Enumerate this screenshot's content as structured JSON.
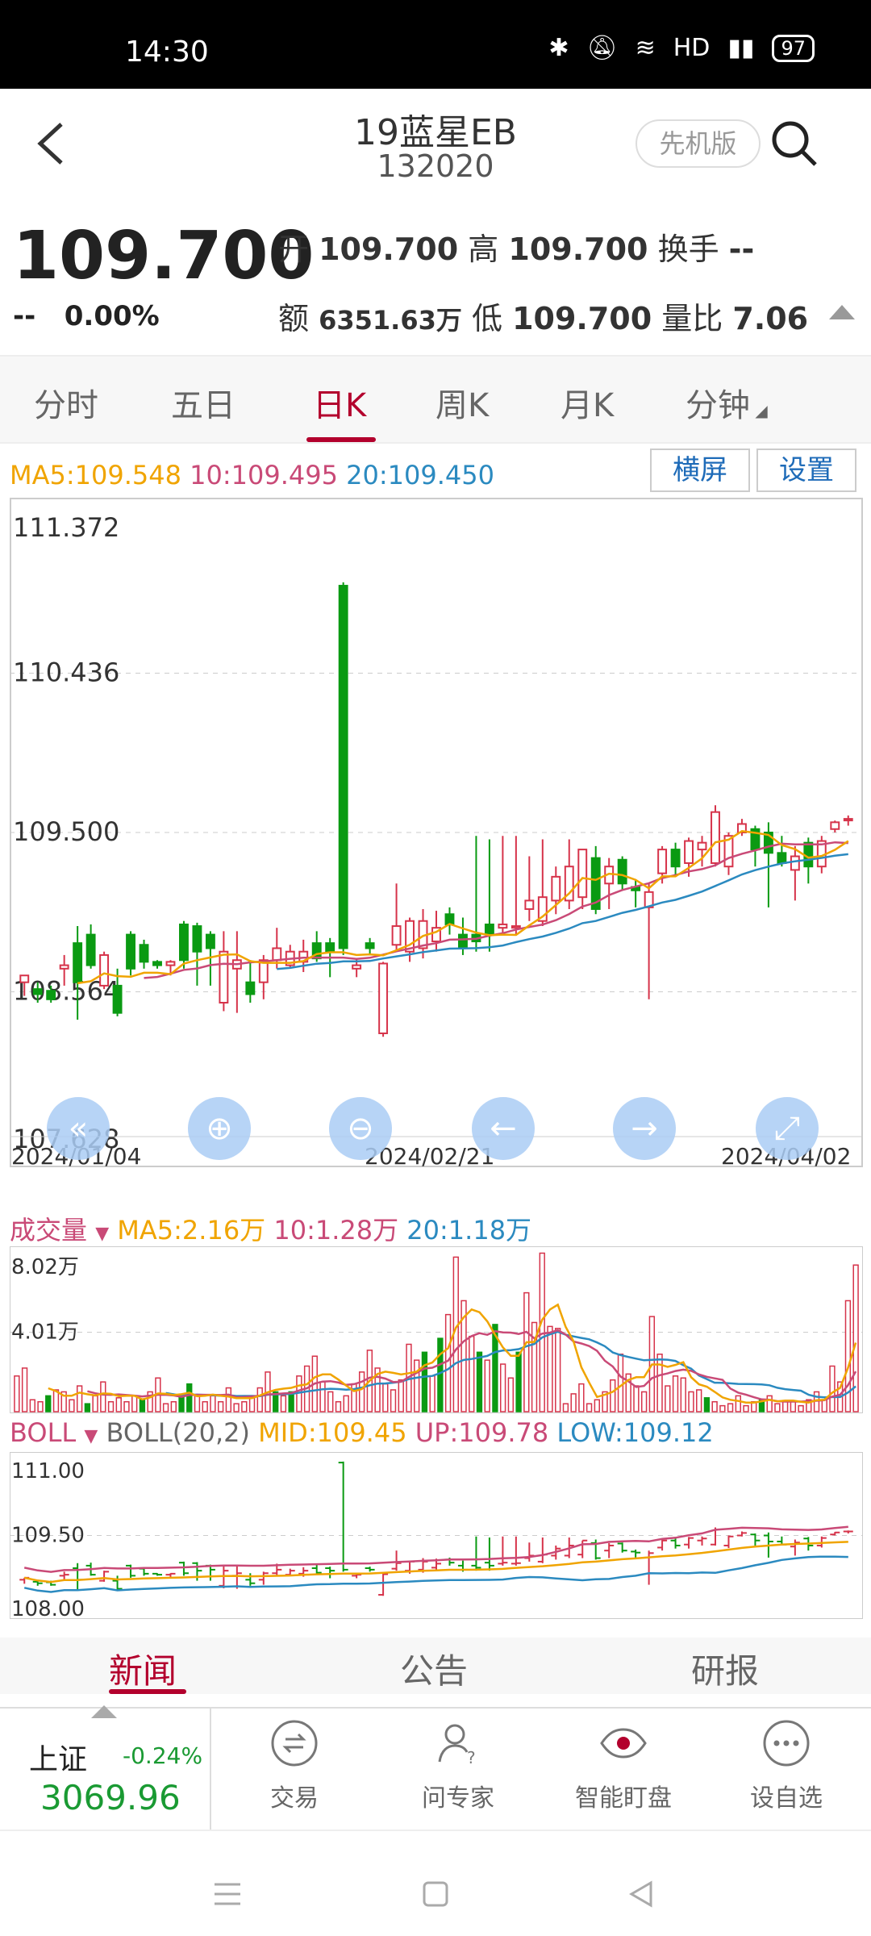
{
  "status": {
    "time": "14:30",
    "network": "HD",
    "battery": "97"
  },
  "header": {
    "title": "19蓝星EB",
    "code": "132020",
    "edition_label": "先机版"
  },
  "quote": {
    "price": "109.700",
    "change": "--",
    "change_pct": "0.00%",
    "open_label": "开",
    "open": "109.700",
    "high_label": "高",
    "high": "109.700",
    "turnover_label": "换手",
    "turnover": "--",
    "amount_label": "额",
    "amount": "6351.63万",
    "low_label": "低",
    "low": "109.700",
    "volratio_label": "量比",
    "volratio": "7.06"
  },
  "tabs": [
    "分时",
    "五日",
    "日K",
    "周K",
    "月K",
    "分钟"
  ],
  "active_tab": "日K",
  "ma": {
    "ma5": "MA5:109.548",
    "ma10": "10:109.495",
    "ma20": "20:109.450"
  },
  "chart_buttons": {
    "landscape": "横屏",
    "settings": "设置"
  },
  "chart_data": [
    {
      "type": "candlestick",
      "y_ticks": [
        "111.372",
        "110.436",
        "109.500",
        "108.564",
        "107.628"
      ],
      "ylim": [
        107.628,
        111.372
      ],
      "x_tick_labels": [
        "2024/01/04",
        "2024/02/21",
        "2024/04/02"
      ],
      "series_colors": {
        "up": "#d6334a",
        "down": "#0a9a12",
        "ma5": "#f0a400",
        "ma10": "#c94a77",
        "ma20": "#2b8ac0"
      },
      "candles": [
        [
          108.62,
          108.66,
          108.54,
          108.66
        ],
        [
          108.58,
          108.62,
          108.5,
          108.55
        ],
        [
          108.57,
          108.6,
          108.5,
          108.52
        ],
        [
          108.7,
          108.78,
          108.6,
          108.72
        ],
        [
          108.85,
          108.95,
          108.4,
          108.62
        ],
        [
          108.9,
          108.96,
          108.7,
          108.72
        ],
        [
          108.6,
          108.8,
          108.58,
          108.78
        ],
        [
          108.6,
          108.7,
          108.42,
          108.44
        ],
        [
          108.9,
          108.92,
          108.66,
          108.7
        ],
        [
          108.84,
          108.87,
          108.7,
          108.74
        ],
        [
          108.74,
          108.75,
          108.7,
          108.72
        ],
        [
          108.72,
          108.75,
          108.66,
          108.74
        ],
        [
          108.96,
          108.98,
          108.7,
          108.75
        ],
        [
          108.95,
          108.97,
          108.6,
          108.8
        ],
        [
          108.9,
          108.92,
          108.6,
          108.82
        ],
        [
          108.5,
          108.92,
          108.45,
          108.8
        ],
        [
          108.7,
          108.92,
          108.44,
          108.75
        ],
        [
          108.62,
          108.75,
          108.5,
          108.55
        ],
        [
          108.62,
          108.78,
          108.52,
          108.75
        ],
        [
          108.75,
          108.94,
          108.7,
          108.82
        ],
        [
          108.72,
          108.84,
          108.7,
          108.8
        ],
        [
          108.74,
          108.87,
          108.68,
          108.8
        ],
        [
          108.85,
          108.92,
          108.74,
          108.76
        ],
        [
          108.85,
          108.88,
          108.65,
          108.8
        ],
        [
          110.95,
          110.97,
          108.78,
          108.82
        ],
        [
          108.7,
          108.76,
          108.65,
          108.72
        ],
        [
          108.85,
          108.88,
          108.78,
          108.82
        ],
        [
          108.32,
          108.74,
          108.3,
          108.73
        ],
        [
          108.84,
          109.2,
          108.8,
          108.95
        ],
        [
          108.8,
          109.0,
          108.74,
          108.98
        ],
        [
          108.82,
          109.05,
          108.76,
          108.98
        ],
        [
          108.86,
          109.04,
          108.8,
          108.94
        ],
        [
          109.02,
          109.06,
          108.9,
          108.96
        ],
        [
          108.9,
          109.0,
          108.78,
          108.82
        ],
        [
          108.9,
          109.48,
          108.8,
          108.86
        ],
        [
          108.96,
          109.46,
          108.8,
          108.9
        ],
        [
          108.94,
          109.48,
          108.9,
          108.96
        ],
        [
          108.94,
          109.48,
          108.9,
          108.95
        ],
        [
          109.05,
          109.36,
          108.98,
          109.1
        ],
        [
          108.98,
          109.46,
          108.95,
          109.12
        ],
        [
          109.1,
          109.3,
          109.02,
          109.24
        ],
        [
          109.1,
          109.46,
          109.05,
          109.3
        ],
        [
          109.12,
          109.4,
          109.05,
          109.4
        ],
        [
          109.35,
          109.42,
          109.02,
          109.05
        ],
        [
          109.2,
          109.35,
          109.05,
          109.3
        ],
        [
          109.34,
          109.36,
          109.16,
          109.2
        ],
        [
          109.18,
          109.22,
          109.06,
          109.16
        ],
        [
          109.06,
          109.2,
          108.52,
          109.15
        ],
        [
          109.26,
          109.42,
          109.2,
          109.4
        ],
        [
          109.4,
          109.44,
          109.24,
          109.3
        ],
        [
          109.32,
          109.47,
          109.24,
          109.45
        ],
        [
          109.4,
          109.48,
          109.3,
          109.44
        ],
        [
          109.32,
          109.66,
          109.3,
          109.62
        ],
        [
          109.3,
          109.5,
          109.25,
          109.48
        ],
        [
          109.5,
          109.58,
          109.48,
          109.55
        ],
        [
          109.52,
          109.54,
          109.3,
          109.4
        ],
        [
          109.5,
          109.56,
          109.06,
          109.38
        ],
        [
          109.38,
          109.48,
          109.3,
          109.32
        ],
        [
          109.28,
          109.42,
          109.1,
          109.36
        ],
        [
          109.44,
          109.47,
          109.2,
          109.3
        ],
        [
          109.3,
          109.48,
          109.26,
          109.45
        ],
        [
          109.52,
          109.57,
          109.5,
          109.56
        ],
        [
          109.58,
          109.6,
          109.54,
          109.58
        ]
      ]
    },
    {
      "type": "bar",
      "title": "成交量",
      "indicator": {
        "ma5": "MA5:2.16万",
        "ma10": "10:1.28万",
        "ma20": "20:1.18万"
      },
      "y_ticks": [
        "8.02万",
        "4.01万"
      ],
      "ylim": [
        0,
        8.02
      ],
      "volumes": [
        1.8,
        2.2,
        0.6,
        0.5,
        0.8,
        1.1,
        1.0,
        0.6,
        1.3,
        0.4,
        0.8,
        1.5,
        0.5,
        0.7,
        0.5,
        0.8,
        0.6,
        1.0,
        1.7,
        0.4,
        0.5,
        0.8,
        1.4,
        0.8,
        0.5,
        0.8,
        0.5,
        1.2,
        0.4,
        0.5,
        0.8,
        1.2,
        2.0,
        1.0,
        0.8,
        1.0,
        1.8,
        2.3,
        2.8,
        1.5,
        1.0,
        0.5,
        0.8,
        1.4,
        2.0,
        3.1,
        2.2,
        1.4,
        1.1,
        1.6,
        3.4,
        2.6,
        3.0,
        1.8,
        3.7,
        4.9,
        7.8,
        5.6,
        3.8,
        3.0,
        2.6,
        4.4,
        2.4,
        1.7,
        3.0,
        6.0,
        4.5,
        8.0,
        4.3,
        4.2,
        0.4,
        0.9,
        1.4,
        0.4,
        0.6,
        1.0,
        1.6,
        2.9,
        1.9,
        1.3,
        1.0,
        4.8,
        2.9,
        1.3,
        1.8,
        1.7,
        1.0,
        1.1,
        0.7,
        0.5,
        0.3,
        0.4,
        0.8,
        0.3,
        0.5,
        0.6,
        0.8,
        0.4,
        0.5,
        0.5,
        0.3,
        0.6,
        1.0,
        0.6,
        2.3,
        1.5,
        5.6,
        7.4
      ],
      "colors": {
        "ma5": "#f0a400",
        "ma10": "#c94a77",
        "ma20": "#2b8ac0"
      }
    },
    {
      "type": "line",
      "title": "BOLL",
      "indicator": {
        "name": "BOLL(20,2)",
        "mid": "MID:109.45",
        "up": "UP:109.78",
        "low": "LOW:109.12"
      },
      "y_ticks": [
        "111.00",
        "109.50",
        "108.00"
      ],
      "ylim": [
        108.0,
        111.0
      ],
      "colors": {
        "mid": "#f0a400",
        "up": "#c94a77",
        "low": "#2b8ac0"
      }
    }
  ],
  "news_tabs": [
    "新闻",
    "公告",
    "研报"
  ],
  "index": {
    "name": "上证",
    "change_pct": "-0.24%",
    "value": "3069.96"
  },
  "actions": [
    "交易",
    "问专家",
    "智能盯盘",
    "设自选"
  ]
}
